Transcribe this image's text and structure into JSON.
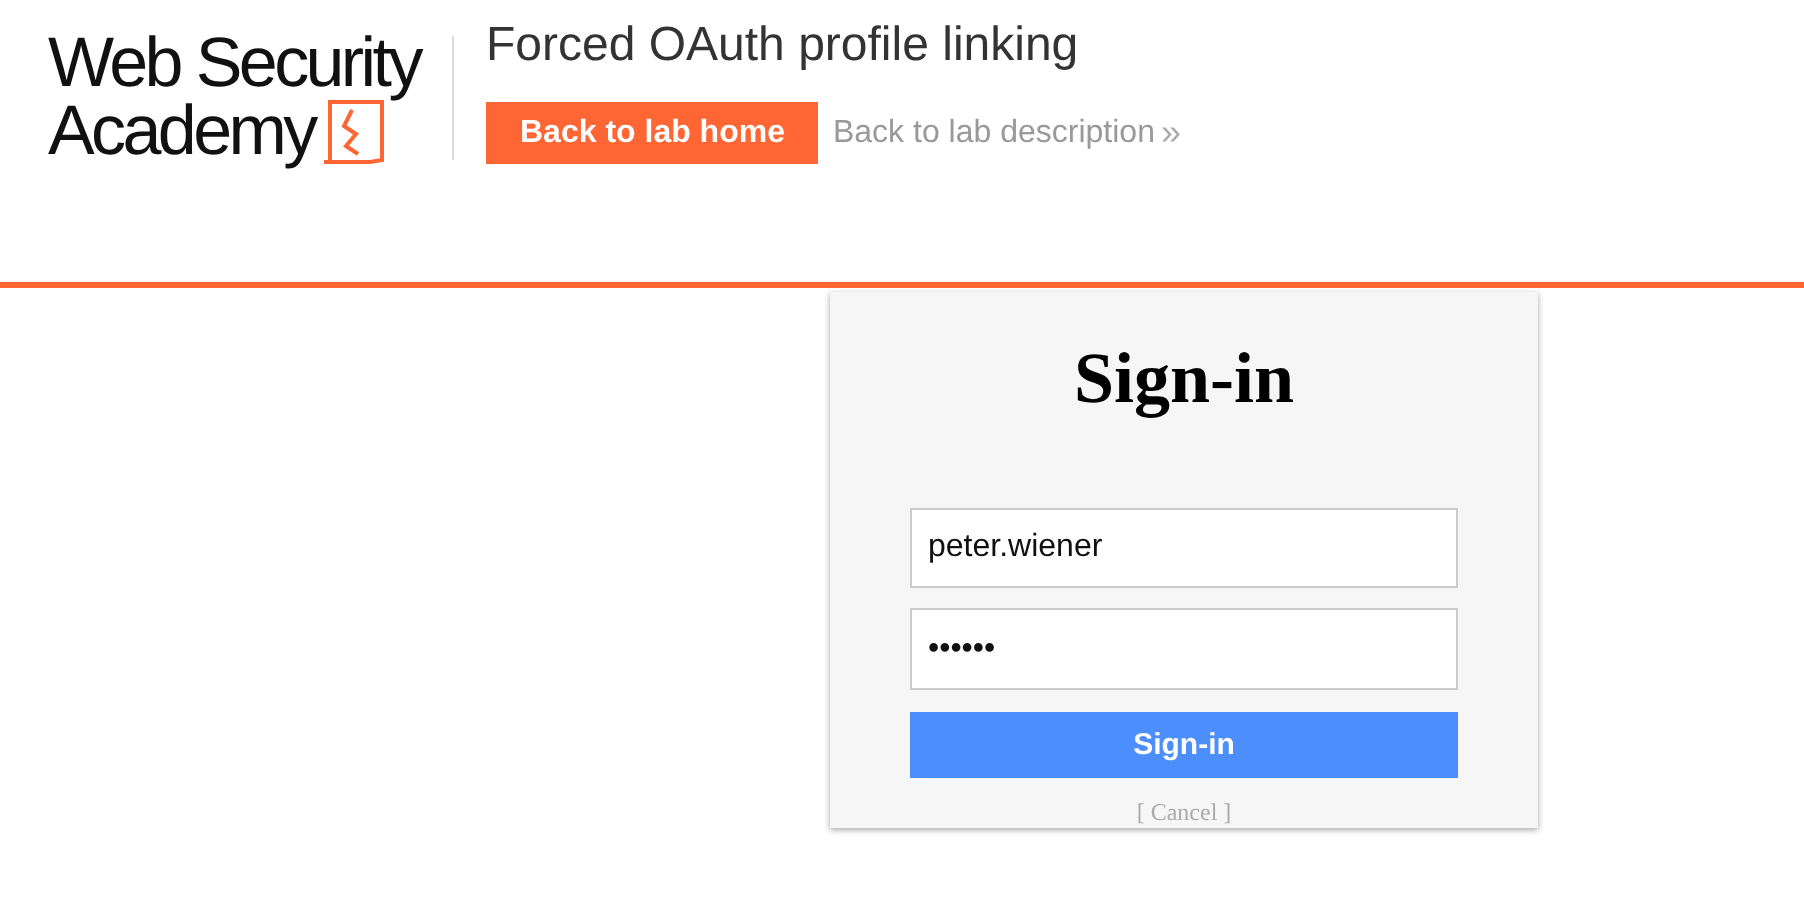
{
  "logo": {
    "line_1": "Web Security",
    "line_2": "Academy"
  },
  "header": {
    "title": "Forced OAuth profile linking",
    "home_button": "Back to lab home",
    "description_link": "Back to lab description",
    "description_link_icon": "»"
  },
  "signin": {
    "heading": "Sign-in",
    "username": {
      "value": "peter.wiener"
    },
    "password": {
      "value": "••••••"
    },
    "submit": "Sign-in",
    "cancel": "[ Cancel ]"
  }
}
